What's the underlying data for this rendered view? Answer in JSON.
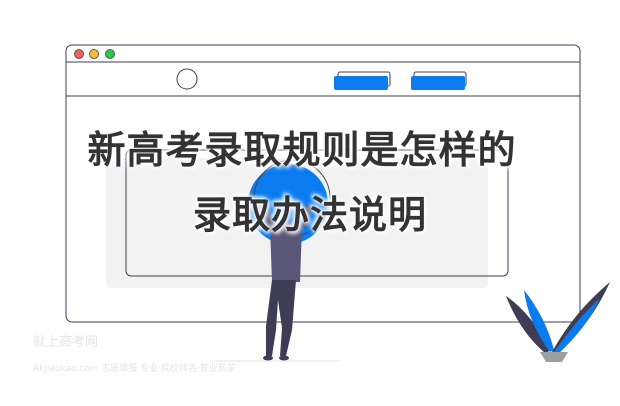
{
  "headline": {
    "line1": "新高考录取规则是怎样的",
    "line2": "录取办法说明"
  },
  "watermark": {
    "line1": "就上高考网",
    "line2": "Akjiaokao.com  志愿填报·专业·院校排名·就业前景"
  },
  "colors": {
    "accent": "#0a7cf0",
    "window_border": "#3f3d56",
    "figure": "#5a5677",
    "panel_fill": "#f2f2f2",
    "traffic_red": "#f55f58",
    "traffic_yellow": "#f8bc2e",
    "traffic_green": "#2fc842"
  },
  "icons": {
    "window_controls": "traffic-light-icon",
    "avatar": "profile-circle-icon",
    "plant": "leaf-plant-icon"
  }
}
